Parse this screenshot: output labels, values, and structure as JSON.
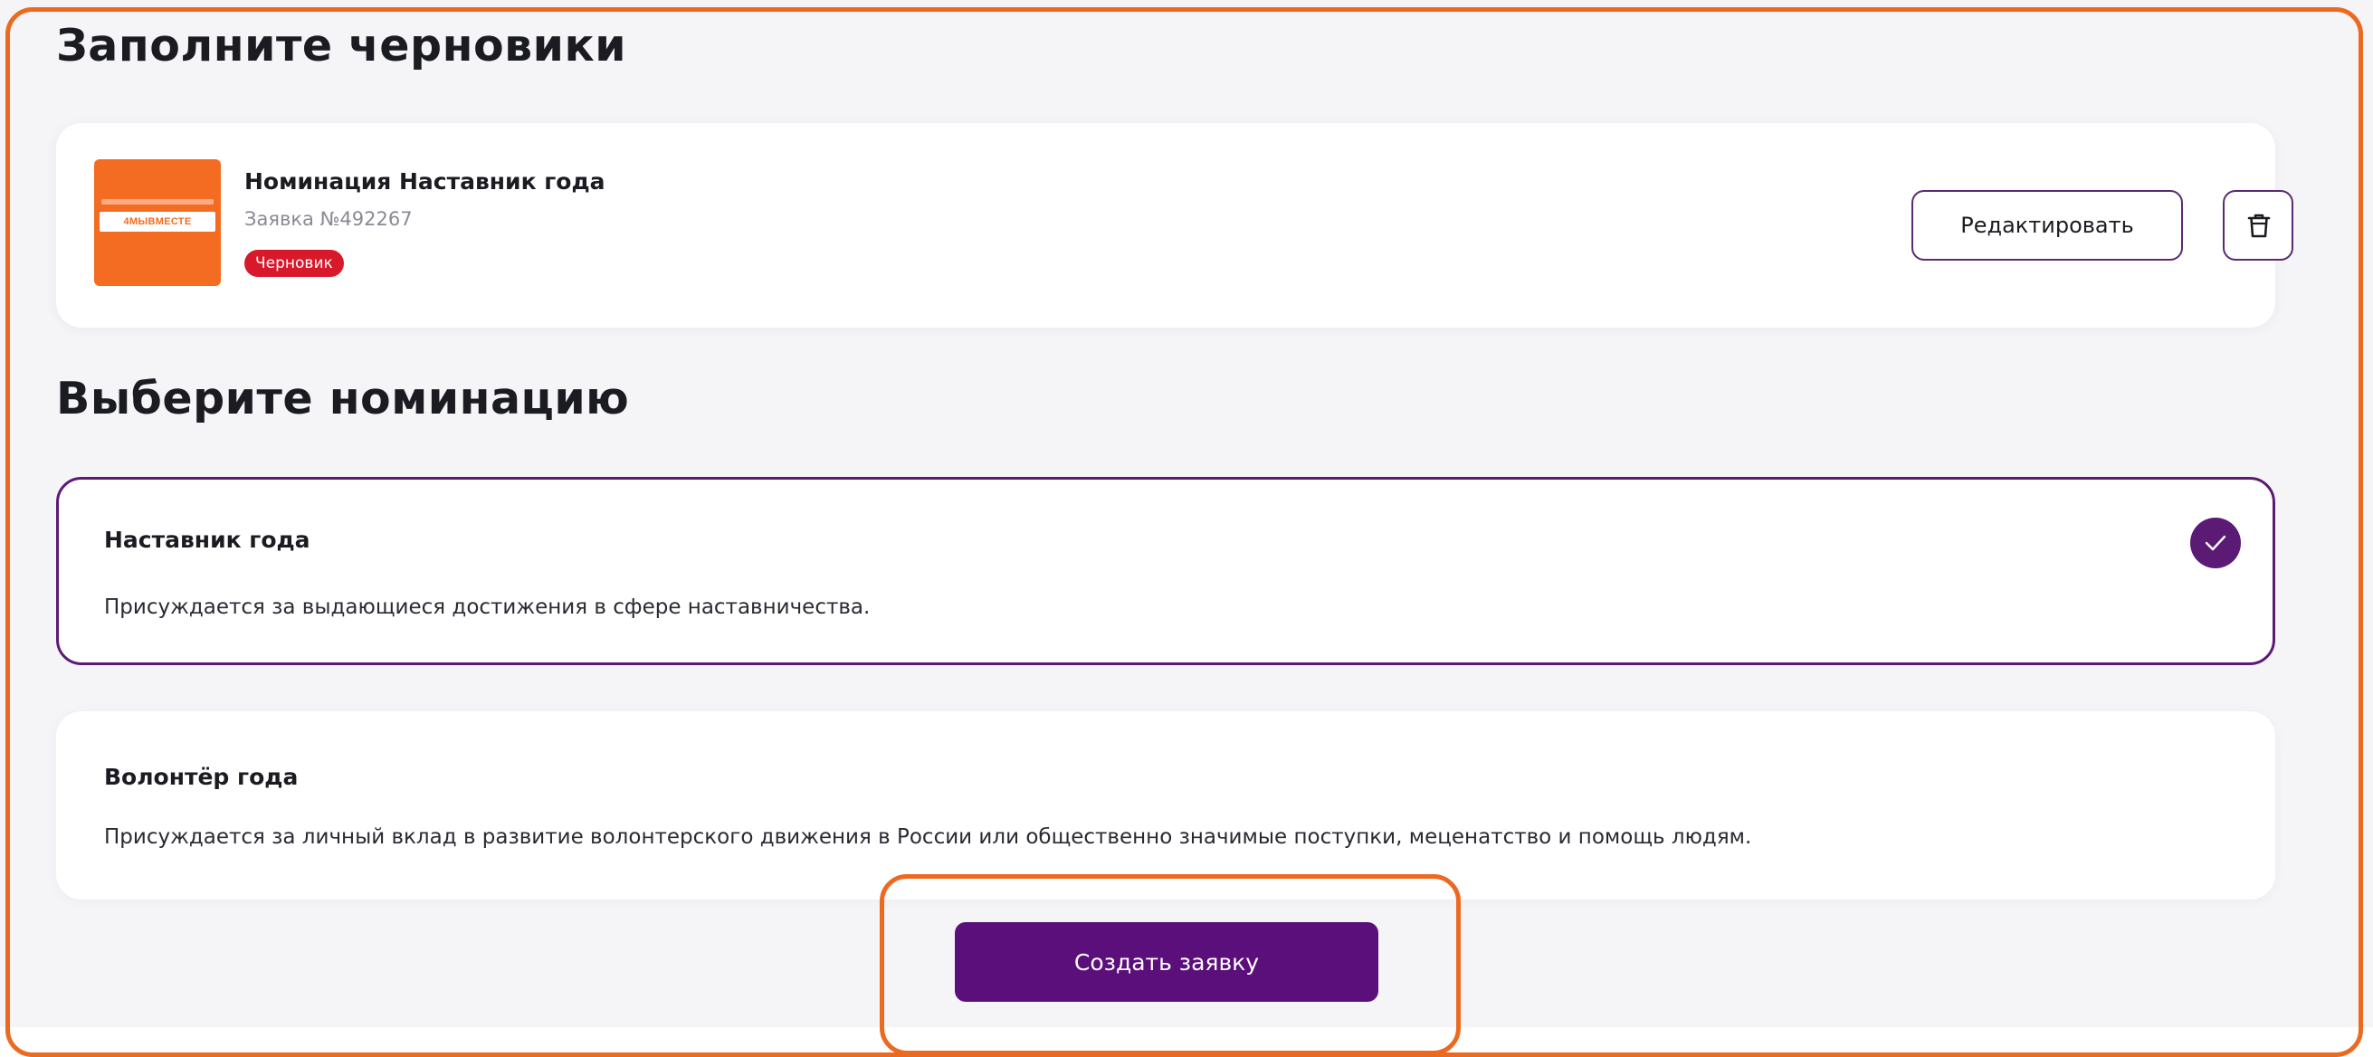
{
  "drafts_section": {
    "title": "Заполните черновики",
    "items": [
      {
        "thumbnail_text": "4МЫВМЕСТЕ",
        "name": "Номинация Наставник года",
        "number": "Заявка №492267",
        "status": "Черновик",
        "edit_label": "Редактировать",
        "delete_icon": "trash-icon"
      }
    ]
  },
  "nominations_section": {
    "title": "Выберите номинацию",
    "items": [
      {
        "title": "Наставник года",
        "description": "Присуждается за выдающиеся достижения в сфере наставничества.",
        "selected": true
      },
      {
        "title": "Волонтёр года",
        "description": "Присуждается за личный вклад в развитие волонтерского движения в России или общественно значимые поступки, меценатство и помощь людям.",
        "selected": false
      }
    ]
  },
  "actions": {
    "create_label": "Создать заявку"
  },
  "colors": {
    "page_background": "#f5f5f8",
    "accent_purple": "#5b0f7a",
    "status_red": "#d8182b",
    "highlight_orange": "#ec6a1f",
    "thumbnail_orange": "#f46b22"
  }
}
